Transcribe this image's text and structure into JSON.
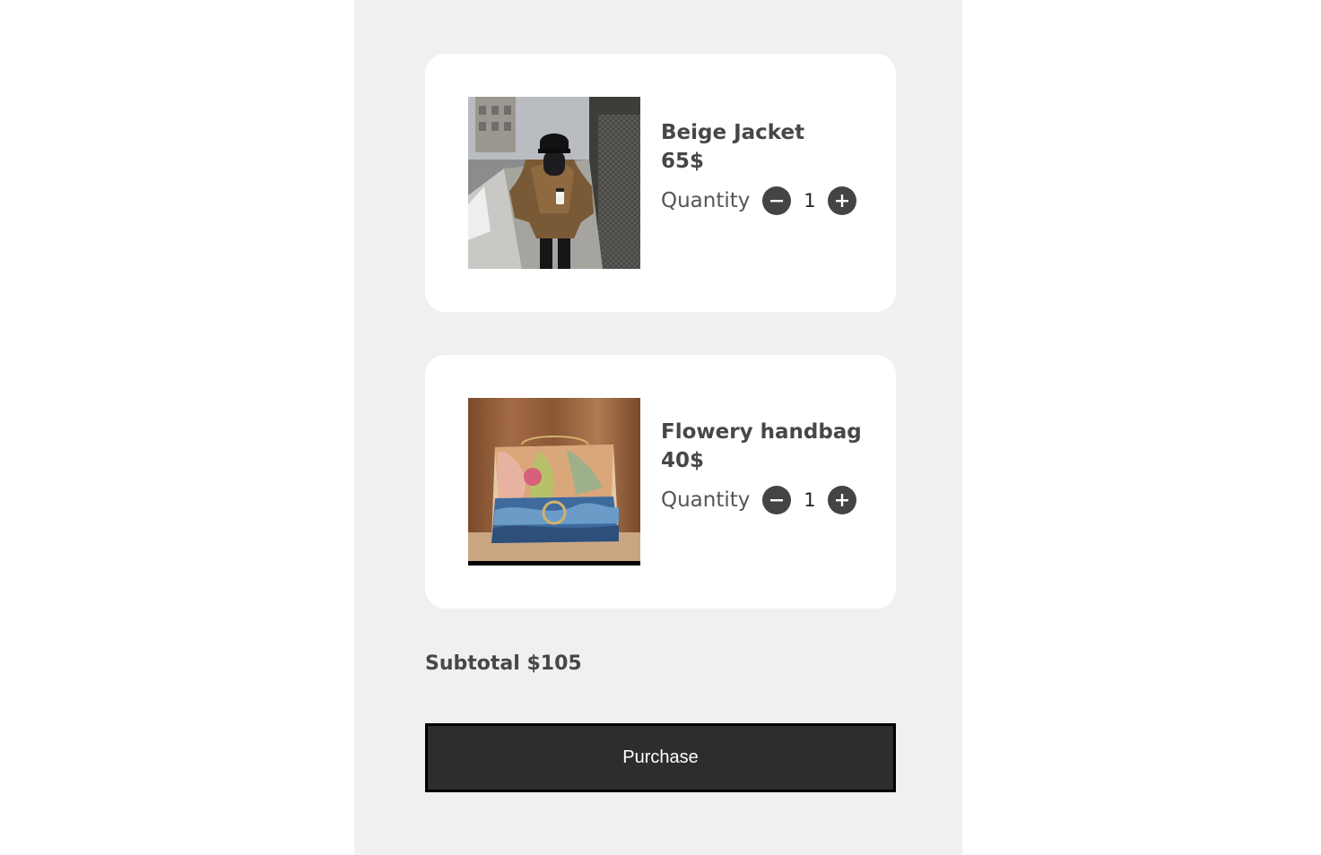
{
  "cart": {
    "items": [
      {
        "name": "Beige Jacket",
        "price": "65$",
        "quantity_label": "Quantity",
        "quantity": "1",
        "image": "person-in-beige-jacket-photo"
      },
      {
        "name": "Flowery handbag",
        "price": "40$",
        "quantity_label": "Quantity",
        "quantity": "1",
        "image": "floral-handbag-photo"
      }
    ],
    "subtotal": "Subtotal $105",
    "purchase_label": "Purchase"
  },
  "icons": {
    "decrease": "minus-icon",
    "increase": "plus-icon"
  },
  "colors": {
    "page_background": "#ffffff",
    "column_background": "#f0f0f0",
    "card_background": "#ffffff",
    "text": "#474747",
    "button_dark": "#2d2d2d",
    "icon_button": "#444444"
  }
}
